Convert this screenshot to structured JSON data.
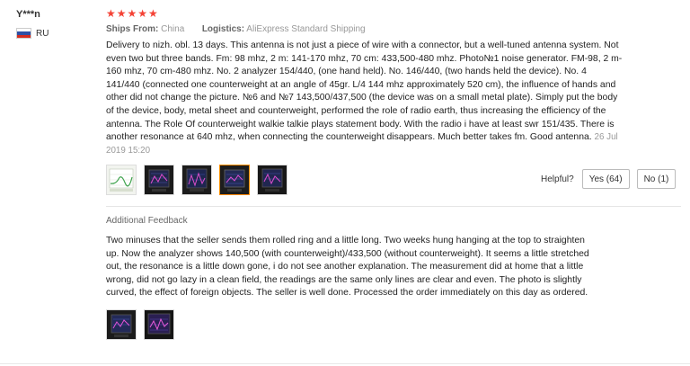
{
  "reviewer": {
    "name": "Y***n",
    "country_code": "RU",
    "flag_colors": [
      "#ffffff",
      "#2d4fa5",
      "#d52b1e"
    ]
  },
  "review": {
    "rating": 5,
    "stars_text": "★★★★★",
    "star_color": "#f44336",
    "ships_from_label": "Ships From:",
    "ships_from_value": "China",
    "logistics_label": "Logistics:",
    "logistics_value": "AliExpress Standard Shipping",
    "text": "Delivery to nizh. obl. 13 days. This antenna is not just a piece of wire with a connector, but a well-tuned antenna system. Not even two but three bands. Fm: 98 mhz, 2 m: 141-170 mhz, 70 cm: 433,500-480 mhz. Photo№1 noise generator. FM-98, 2 m-160 mhz, 70 cm-480 mhz. No. 2 analyzer 154/440, (one hand held). No. 146/440, (two hands held the device). No. 4 141/440 (connected one counterweight at an angle of 45gr. L/4 144 mhz approximately 520 cm), the influence of hands and other did not change the picture. №6 and №7 143,500/437,500 (the device was on a small metal plate). Simply put the body of the device, body, metal sheet and counterweight, performed the role of radio earth, thus increasing the efficiency of the antenna. The Role Of counterweight walkie talkie plays statement body. With the radio i have at least swr 151/435. There is another resonance at 640 mhz, when connecting the counterweight disappears. Much better takes fm. Good antenna.",
    "date": "26 Jul 2019 15:20",
    "photos": [
      "review-photo-1",
      "review-photo-2",
      "review-photo-3",
      "review-photo-4",
      "review-photo-5"
    ],
    "selected_photo": 3
  },
  "helpful": {
    "label": "Helpful?",
    "yes": "Yes (64)",
    "no": "No (1)"
  },
  "additional_feedback": {
    "title": "Additional Feedback",
    "text": "Two minuses that the seller sends them rolled ring and a little long. Two weeks hung hanging at the top to straighten up. Now the analyzer shows 140,500 (with counterweight)/433,500 (without counterweight). It seems a little stretched out, the resonance is a little down gone, i do not see another explanation. The measurement did at home that a little wrong, did not go lazy in a clean field, the readings are the same only lines are clear and even. The photo is slightly curved, the effect of foreign objects. The seller is well done. Processed the order immediately on this day as ordered.",
    "photos": [
      "additional-photo-1",
      "additional-photo-2"
    ]
  }
}
